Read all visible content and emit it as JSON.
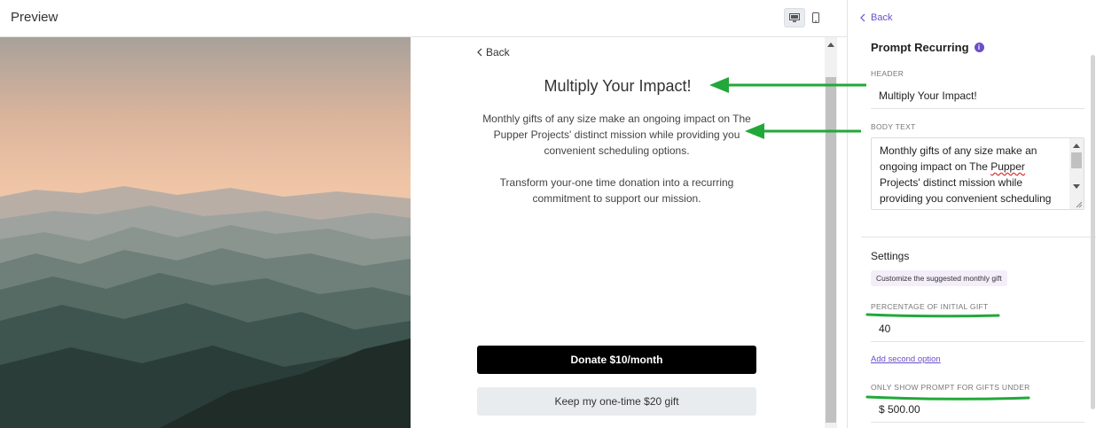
{
  "preview": {
    "title": "Preview",
    "desktop_icon": "desktop-icon",
    "mobile_icon": "mobile-icon"
  },
  "content": {
    "back_label": "Back",
    "header": "Multiply Your Impact!",
    "body_p1": "Monthly gifts of any size make an ongoing impact on The Pupper Projects' distinct mission while providing you convenient scheduling options.",
    "body_p2": "Transform your-one time donation into a recurring commitment to support our mission.",
    "primary_button": "Donate $10/month",
    "secondary_button": "Keep my one-time $20 gift"
  },
  "panel": {
    "back_label": "Back",
    "title": "Prompt Recurring",
    "header_label": "HEADER",
    "header_value": "Multiply Your Impact!",
    "body_label": "BODY TEXT",
    "body_value_before": "Monthly gifts of any size make an ongoing impact on The ",
    "body_value_misspelled": "Pupper",
    "body_value_after": " Projects' distinct mission while providing you convenient scheduling options.",
    "settings_title": "Settings",
    "settings_badge": "Customize the suggested monthly gift",
    "percentage_label": "PERCENTAGE OF INITIAL GIFT",
    "percentage_value": "40",
    "add_option_link": "Add second option",
    "threshold_label": "ONLY SHOW PROMPT FOR GIFTS UNDER",
    "threshold_value": "$ 500.00"
  },
  "colors": {
    "accent": "#6b4fc8",
    "annotation": "#22a83a",
    "primary_button_bg": "#000000",
    "secondary_button_bg": "#e9ecef"
  }
}
